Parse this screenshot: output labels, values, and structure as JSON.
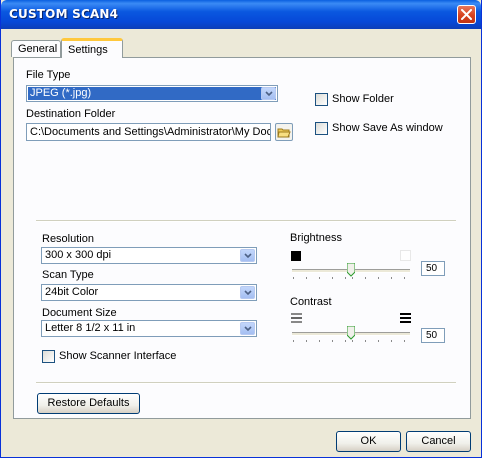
{
  "window": {
    "title": "CUSTOM SCAN4"
  },
  "tabs": [
    {
      "label": "General"
    },
    {
      "label": "Settings"
    }
  ],
  "file_type": {
    "label": "File Type",
    "value": "JPEG (*.jpg)"
  },
  "destination": {
    "label": "Destination Folder",
    "value": "C:\\Documents and Settings\\Administrator\\My Docum"
  },
  "options": {
    "show_folder": "Show Folder",
    "show_save_as": "Show Save As window"
  },
  "resolution": {
    "label": "Resolution",
    "value": "300 x 300 dpi"
  },
  "scan_type": {
    "label": "Scan Type",
    "value": "24bit Color"
  },
  "document_size": {
    "label": "Document Size",
    "value": "Letter 8 1/2 x 11 in"
  },
  "show_scanner_interface": "Show Scanner Interface",
  "brightness": {
    "label": "Brightness",
    "value": "50",
    "level": 0.5
  },
  "contrast": {
    "label": "Contrast",
    "value": "50",
    "level": 0.5
  },
  "buttons": {
    "restore_defaults": "Restore Defaults",
    "ok": "OK",
    "cancel": "Cancel"
  },
  "colors": {
    "title_bar": "#0a58e0",
    "selection": "#316ac5",
    "dialog_bg": "#ece9d8",
    "close_button": "#d6421f"
  },
  "icons": {
    "close": "close-icon",
    "folder": "folder-icon",
    "dropdown": "chevron-down-icon"
  }
}
